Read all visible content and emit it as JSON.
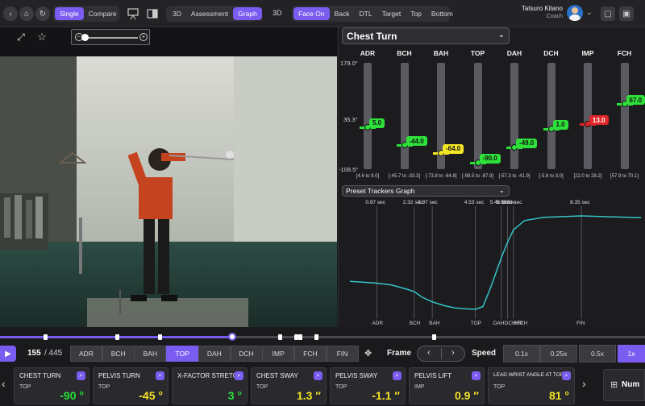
{
  "topbar": {
    "mode_tabs": [
      "Single",
      "Compare"
    ],
    "mode_active": "Single",
    "view_tabs": [
      "3D",
      "Assessment",
      "Graph"
    ],
    "view_active": "Graph",
    "label_3d": "3D",
    "camera_tabs": [
      "Face On",
      "Back",
      "DTL",
      "Target",
      "Top",
      "Bottom"
    ],
    "camera_active": "Face On",
    "user_name": "Tatsuro Kitano",
    "user_role": "Coach"
  },
  "graph_panel": {
    "metric_dropdown": "Chest Turn",
    "y_max": "179.0°",
    "y_mid": "35.3°",
    "y_min": "-108.5°",
    "events": [
      {
        "label": "ADR",
        "value": "5.0",
        "range": "[4.6 to 9.0]",
        "status": "green"
      },
      {
        "label": "BCH",
        "value": "-44.0",
        "range": "[-45.7 to -33.3]",
        "status": "green"
      },
      {
        "label": "BAH",
        "value": "-64.0",
        "range": "[-73.8 to -64.8]",
        "status": "yellow"
      },
      {
        "label": "TOP",
        "value": "-90.0",
        "range": "[-98.5 to -87.9]",
        "status": "green"
      },
      {
        "label": "DAH",
        "value": "-49.0",
        "range": "[-57.3 to -41.9]",
        "status": "green"
      },
      {
        "label": "DCH",
        "value": "1.0",
        "range": "[-5.8 to 3.0]",
        "status": "green"
      },
      {
        "label": "IMP",
        "value": "13.0",
        "range": "[22.0 to 28.2]",
        "status": "red"
      },
      {
        "label": "FCH",
        "value": "67.0",
        "range": "[57.9 to 70.1]",
        "status": "green"
      }
    ],
    "tracker_dropdown": "Preset Trackers Graph",
    "time_labels": [
      "0.97 sec",
      "2.32 sec",
      "2.97 sec",
      "4.53 sec",
      "5.46 sec",
      "5.69 sec",
      "5.90 sec",
      "8.35 sec"
    ],
    "event_axis_labels": [
      "ADR",
      "BCH",
      "BAH",
      "TOP",
      "DAH",
      "DCH",
      "IMP",
      "FCH",
      "FIN"
    ]
  },
  "chart_data": {
    "type": "line",
    "title": "",
    "xlabel": "",
    "ylabel": "",
    "series": [
      {
        "values": [
          [
            0.0,
            0.3
          ],
          [
            0.5,
            0.29
          ],
          [
            0.97,
            0.28
          ],
          [
            1.5,
            0.26
          ],
          [
            2.0,
            0.22
          ],
          [
            2.32,
            0.19
          ],
          [
            2.6,
            0.13
          ],
          [
            2.97,
            0.08
          ],
          [
            3.4,
            0.04
          ],
          [
            3.8,
            0.015
          ],
          [
            4.2,
            0.005
          ],
          [
            4.53,
            0.0
          ],
          [
            4.8,
            0.03
          ],
          [
            5.1,
            0.25
          ],
          [
            5.46,
            0.55
          ],
          [
            5.69,
            0.72
          ],
          [
            5.9,
            0.85
          ],
          [
            6.3,
            0.95
          ],
          [
            7.0,
            0.985
          ],
          [
            8.35,
            1.0
          ],
          [
            9.5,
            0.99
          ],
          [
            10.5,
            0.98
          ]
        ]
      }
    ],
    "xlim": [
      0,
      10.5
    ],
    "ylim": [
      0,
      1
    ],
    "grid": false
  },
  "video_toolbar": {
    "fullscreen_label": "⤢",
    "bookmark_label": "☆",
    "zoom_out": "−",
    "zoom_in": "+"
  },
  "controls": {
    "frame_current": "155",
    "frame_total": "/ 445",
    "events": [
      "ADR",
      "BCH",
      "BAH",
      "TOP",
      "DAH",
      "DCH",
      "IMP",
      "FCH",
      "FIN"
    ],
    "event_active": "TOP",
    "frame_label": "Frame",
    "speed_label": "Speed",
    "speeds": [
      "0.1x",
      "0.25x",
      "0.5x",
      "1x"
    ],
    "speed_active": "1x"
  },
  "metrics": [
    {
      "title": "CHEST TURN",
      "event": "TOP",
      "value": "-90 °",
      "color": "green"
    },
    {
      "title": "PELVIS TURN",
      "event": "TOP",
      "value": "-45 °",
      "color": "yellow"
    },
    {
      "title": "X-FACTOR STRETCH",
      "event": "",
      "value": "3 °",
      "color": "green"
    },
    {
      "title": "CHEST SWAY",
      "event": "TOP",
      "value": "1.3 ″",
      "color": "yellow"
    },
    {
      "title": "PELVIS SWAY",
      "event": "TOP",
      "value": "-1.1 ″",
      "color": "yellow"
    },
    {
      "title": "PELVIS LIFT",
      "event": "IMP",
      "value": "0.9 ″",
      "color": "yellow"
    },
    {
      "title": "LEAD WRIST ANGLE AT TOP",
      "event": "TOP",
      "value": "81 °",
      "color": "yellow"
    }
  ],
  "num_button": "Num"
}
